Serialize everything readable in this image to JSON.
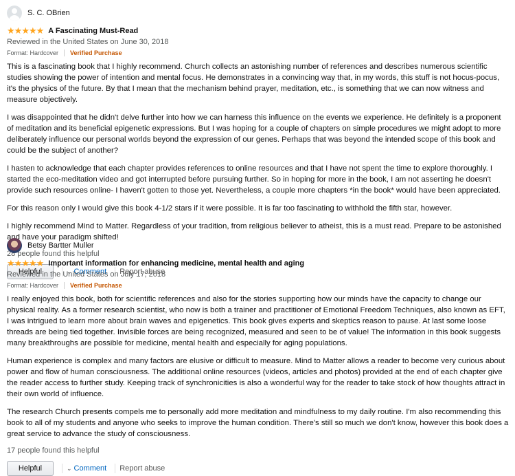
{
  "reviews": [
    {
      "reviewer": "S. C. OBrien",
      "avatar_icon": "default-user-avatar",
      "rating": 5,
      "title": "A Fascinating Must-Read",
      "date": "Reviewed in the United States on June 30, 2018",
      "format": "Format: Hardcover",
      "verified": "Verified Purchase",
      "paragraphs": [
        "This is a fascinating book that I highly recommend. Church collects an astonishing number of references and describes numerous scientific studies showing the power of intention and mental focus. He demonstrates in a convincing way that, in my words, this stuff is not hocus-pocus, it's the physics of the future. By that I mean that the mechanism behind prayer, meditation, etc., is something that we can now witness and measure objectively.",
        "I was disappointed that he didn't delve further into how we can harness this influence on the events we experience. He definitely is a proponent of meditation and its beneficial epigenetic expressions. But I was hoping for a couple of chapters on simple procedures we might adopt to more deliberately influence our personal worlds beyond the expression of our genes. Perhaps that was beyond the intended scope of this book and could be the subject of another?",
        "I hasten to acknowledge that each chapter provides references to online resources and that I have not spent the time to explore thoroughly. I started the eco-meditation video and got interrupted before pursuing further. So in hoping for more in the book, I am not asserting he doesn't provide such resources online- I haven't gotten to those yet. Nevertheless, a couple more chapters *in the book* would have been appreciated.",
        "For this reason only I would give this book 4-1/2 stars if it were possible. It is far too fascinating to withhold the fifth star, however.",
        "I highly recommend Mind to Matter. Regardless of your tradition, from religious believer to atheist, this is a must read. Prepare to be astonished and have your paradigm shifted!"
      ],
      "helpful_count": "28 people found this helpful",
      "helpful_label": "Helpful",
      "comment_label": "Comment",
      "report_label": "Report abuse"
    },
    {
      "reviewer": "Betsy Bartter Muller",
      "avatar_icon": "user-photo-avatar",
      "rating": 5,
      "title": "Important information for enhancing medicine, mental health and aging",
      "date": "Reviewed in the United States on July 17, 2018",
      "format": "Format: Hardcover",
      "verified": "Verified Purchase",
      "paragraphs": [
        "I really enjoyed this book, both for scientific references and also for the stories supporting how our minds have the capacity to change our physical reality. As a former research scientist, who now is both a trainer and practitioner of Emotional Freedom Techniques, also known as EFT, I was intrigued to learn more about brain waves and epigenetics. This book gives experts and skeptics reason to pause. At last some loose threads are being tied together. Invisible forces are being recognized, measured and seen to be of value! The information in this book suggests many breakthroughs are possible for medicine, mental health and especially for aging populations.",
        "Human experience is complex and many factors are elusive or difficult to measure. Mind to Matter allows a reader to become very curious about power and flow of human consciousness. The additional online resources (videos, articles and photos) provided at the end of each chapter give the reader access to further study. Keeping track of synchronicities is also a wonderful way for the reader to take stock of how thoughts attract in their own world of influence.",
        "The research Church presents compels me to personally add more meditation and mindfulness to my daily routine. I'm also recommending this book to all of my students and anyone who seeks to improve the human condition. There's still so much we don't know, however this book does a great service to advance the study of consciousness."
      ],
      "helpful_count": "17 people found this helpful",
      "helpful_label": "Helpful",
      "comment_label": "Comment",
      "report_label": "Report abuse"
    }
  ]
}
